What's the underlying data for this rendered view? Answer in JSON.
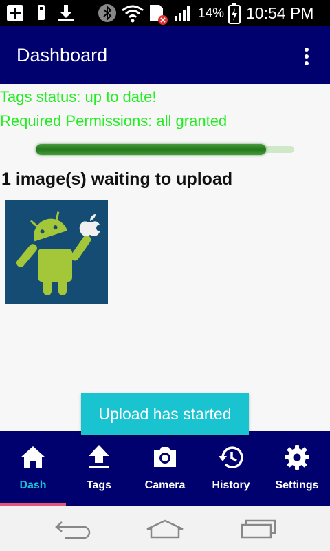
{
  "status_bar": {
    "battery_percent": "14%",
    "time": "10:54 PM",
    "icons": [
      "add-box-icon",
      "usb-icon",
      "download-icon",
      "bluetooth-icon",
      "wifi-icon",
      "sim-error-icon",
      "signal-icon",
      "battery-charging-icon"
    ]
  },
  "appbar": {
    "title": "Dashboard",
    "menu_icon": "more-vert-icon"
  },
  "content": {
    "tags_status": "Tags status: up to date!",
    "permissions_status": "Required Permissions: all granted",
    "progress_fraction": 0.89,
    "upload_heading": "1 image(s) waiting to upload",
    "thumbnail_icon": "android-eating-apple-image"
  },
  "toast": {
    "message": "Upload has started"
  },
  "bottom_nav": {
    "items": [
      {
        "label": "Dash",
        "icon": "home-icon",
        "active": true
      },
      {
        "label": "Tags",
        "icon": "upload-icon",
        "active": false
      },
      {
        "label": "Camera",
        "icon": "camera-icon",
        "active": false
      },
      {
        "label": "History",
        "icon": "history-icon",
        "active": false
      },
      {
        "label": "Settings",
        "icon": "gear-icon",
        "active": false
      }
    ]
  },
  "system_nav": {
    "icons": [
      "back-icon",
      "home-outline-icon",
      "recents-icon"
    ]
  },
  "colors": {
    "primary": "#00006e",
    "accent": "#19c3d0",
    "status_text": "#22ee22",
    "indicator": "#e8537a"
  }
}
